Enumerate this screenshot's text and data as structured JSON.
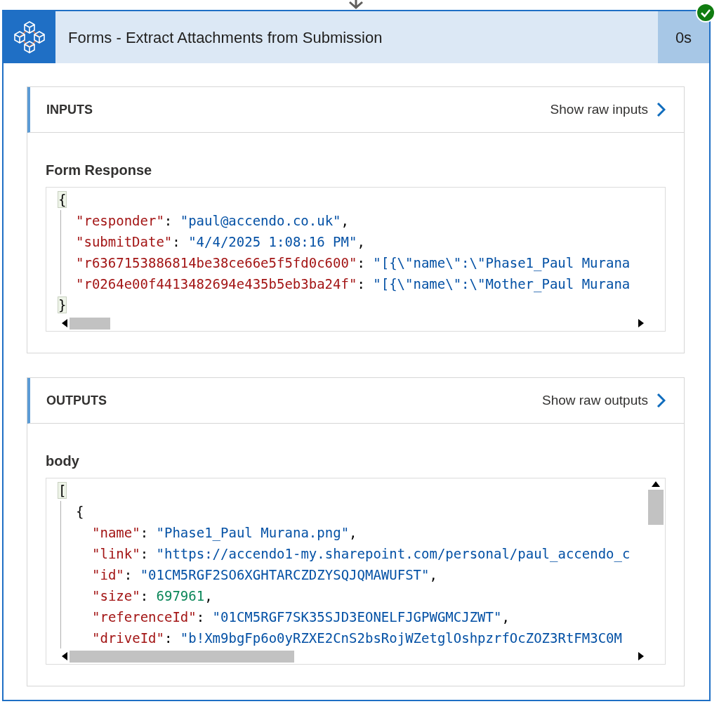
{
  "card": {
    "title": "Forms - Extract Attachments from Submission",
    "duration": "0s",
    "succeeded": true
  },
  "sections": [
    {
      "heading": "INPUTS",
      "raw_link": "Show raw inputs",
      "fields": [
        {
          "label": "Form Response",
          "kind": "wide",
          "lines": [
            {
              "tokens": [
                {
                  "kind": "matched_bracket",
                  "text": "{"
                }
              ],
              "children": [
                {
                  "tokens": [
                    {
                      "kind": "key",
                      "text": "\"responder\""
                    },
                    {
                      "kind": "punct",
                      "text": ": "
                    },
                    {
                      "kind": "string",
                      "text": "\"paul@accendo.co.uk\""
                    },
                    {
                      "kind": "punct",
                      "text": ","
                    }
                  ]
                },
                {
                  "tokens": [
                    {
                      "kind": "key",
                      "text": "\"submitDate\""
                    },
                    {
                      "kind": "punct",
                      "text": ": "
                    },
                    {
                      "kind": "string",
                      "text": "\"4/4/2025 1:08:16 PM\""
                    },
                    {
                      "kind": "punct",
                      "text": ","
                    }
                  ]
                },
                {
                  "tokens": [
                    {
                      "kind": "key",
                      "text": "\"r6367153886814be38ce66e5f5fd0c600\""
                    },
                    {
                      "kind": "punct",
                      "text": ": "
                    },
                    {
                      "kind": "string",
                      "text": "\"[{\\\"name\\\":\\\"Phase1_Paul Murana"
                    }
                  ]
                },
                {
                  "tokens": [
                    {
                      "kind": "key",
                      "text": "\"r0264e00f4413482694e435b5eb3ba24f\""
                    },
                    {
                      "kind": "punct",
                      "text": ": "
                    },
                    {
                      "kind": "string",
                      "text": "\"[{\\\"name\\\":\\\"Mother_Paul Murana"
                    }
                  ]
                }
              ]
            },
            {
              "tokens": [
                {
                  "kind": "matched_bracket",
                  "text": "}"
                }
              ]
            }
          ]
        }
      ]
    },
    {
      "heading": "OUTPUTS",
      "raw_link": "Show raw outputs",
      "fields": [
        {
          "label": "body",
          "kind": "scrolling",
          "lines": [
            {
              "tokens": [
                {
                  "kind": "matched_bracket",
                  "text": "["
                }
              ],
              "children": [
                {
                  "tokens": [
                    {
                      "kind": "punct",
                      "text": "{"
                    }
                  ],
                  "children": [
                    {
                      "tokens": [
                        {
                          "kind": "key",
                          "text": "\"name\""
                        },
                        {
                          "kind": "punct",
                          "text": ": "
                        },
                        {
                          "kind": "string",
                          "text": "\"Phase1_Paul Murana.png\""
                        },
                        {
                          "kind": "punct",
                          "text": ","
                        }
                      ]
                    },
                    {
                      "tokens": [
                        {
                          "kind": "key",
                          "text": "\"link\""
                        },
                        {
                          "kind": "punct",
                          "text": ": "
                        },
                        {
                          "kind": "string",
                          "text": "\"https://accendo1-my.sharepoint.com/personal/paul_accendo_c"
                        }
                      ]
                    },
                    {
                      "tokens": [
                        {
                          "kind": "key",
                          "text": "\"id\""
                        },
                        {
                          "kind": "punct",
                          "text": ": "
                        },
                        {
                          "kind": "string",
                          "text": "\"01CM5RGF2SO6XGHTARCZDZYSQJQMAWUFST\""
                        },
                        {
                          "kind": "punct",
                          "text": ","
                        }
                      ]
                    },
                    {
                      "tokens": [
                        {
                          "kind": "key",
                          "text": "\"size\""
                        },
                        {
                          "kind": "punct",
                          "text": ": "
                        },
                        {
                          "kind": "number",
                          "text": "697961"
                        },
                        {
                          "kind": "punct",
                          "text": ","
                        }
                      ]
                    },
                    {
                      "tokens": [
                        {
                          "kind": "key",
                          "text": "\"referenceId\""
                        },
                        {
                          "kind": "punct",
                          "text": ": "
                        },
                        {
                          "kind": "string",
                          "text": "\"01CM5RGF7SK35SJD3EONELFJGPWGMCJZWT\""
                        },
                        {
                          "kind": "punct",
                          "text": ","
                        }
                      ]
                    },
                    {
                      "tokens": [
                        {
                          "kind": "key",
                          "text": "\"driveId\""
                        },
                        {
                          "kind": "punct",
                          "text": ": "
                        },
                        {
                          "kind": "string",
                          "text": "\"b!Xm9bgFp6o0yRZXE2CnS2bsRojWZetglOshpzrfOcZOZ3RtFM3C0M"
                        }
                      ]
                    }
                  ]
                }
              ]
            }
          ]
        }
      ]
    }
  ]
}
